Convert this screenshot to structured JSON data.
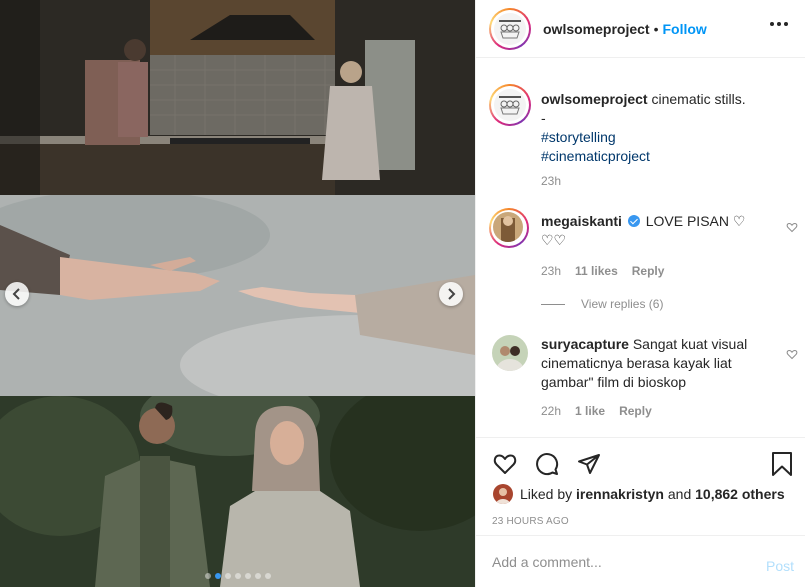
{
  "post": {
    "carousel": {
      "slides": 7,
      "active_slide": 2
    },
    "header": {
      "username": "owlsomeproject",
      "separator": "•",
      "follow_label": "Follow"
    },
    "caption": {
      "username": "owlsomeproject",
      "text": "cinematic stills.",
      "dash": "-",
      "tags": [
        "#storytelling",
        "#cinematicproject"
      ],
      "time": "23h"
    },
    "comments": [
      {
        "username": "megaiskanti",
        "verified": true,
        "text": "LOVE PISAN ♡ ♡♡",
        "time": "23h",
        "likes": "11 likes",
        "reply_label": "Reply",
        "view_replies": "View replies (6)"
      },
      {
        "username": "suryacapture",
        "text": "Sangat kuat visual cinematicnya berasa kayak liat gambar\" film di bioskop",
        "time": "22h",
        "likes": "1 like",
        "reply_label": "Reply"
      }
    ],
    "liked_by": {
      "prefix": "Liked by",
      "user": "irennakristyn",
      "and": "and",
      "others": "10,862 others"
    },
    "timestamp": "23 HOURS AGO",
    "add_comment": {
      "placeholder": "Add a comment...",
      "post_label": "Post"
    }
  },
  "colors": {
    "accent": "#0095f6",
    "verified": "#3897f0",
    "muted": "#8e8e8e",
    "hashtag": "#00376b"
  },
  "icons": [
    "chevron-left-icon",
    "chevron-right-icon",
    "more-icon",
    "heart-icon",
    "comment-icon",
    "share-icon",
    "bookmark-icon",
    "verified-icon"
  ]
}
